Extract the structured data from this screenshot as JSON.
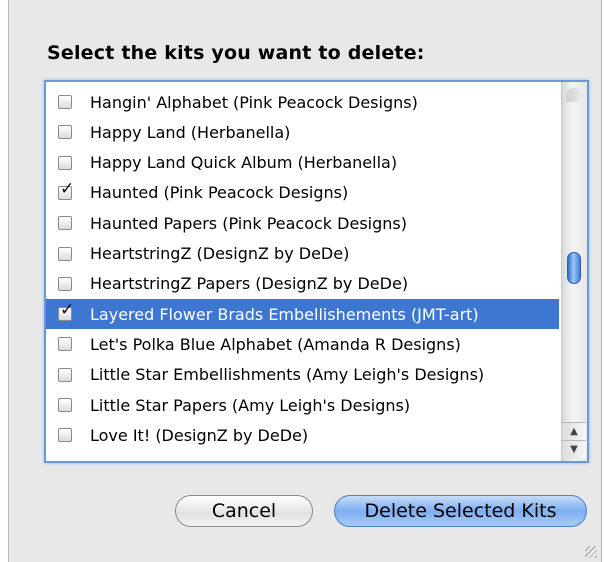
{
  "dialog": {
    "prompt": "Select the kits you want to delete:"
  },
  "kits": [
    {
      "label": "Hangin' Alphabet (Pink Peacock Designs)",
      "checked": false,
      "selected": false
    },
    {
      "label": "Happy Land (Herbanella)",
      "checked": false,
      "selected": false
    },
    {
      "label": "Happy Land Quick Album (Herbanella)",
      "checked": false,
      "selected": false
    },
    {
      "label": "Haunted (Pink Peacock Designs)",
      "checked": true,
      "selected": false
    },
    {
      "label": "Haunted Papers (Pink Peacock Designs)",
      "checked": false,
      "selected": false
    },
    {
      "label": "HeartstringZ (DesignZ by DeDe)",
      "checked": false,
      "selected": false
    },
    {
      "label": "HeartstringZ Papers (DesignZ by DeDe)",
      "checked": false,
      "selected": false
    },
    {
      "label": "Layered Flower Brads Embellishements (JMT-art)",
      "checked": true,
      "selected": true
    },
    {
      "label": "Let's Polka Blue Alphabet (Amanda R Designs)",
      "checked": false,
      "selected": false
    },
    {
      "label": "Little Star Embellishments (Amy Leigh's Designs)",
      "checked": false,
      "selected": false
    },
    {
      "label": "Little Star Papers (Amy Leigh's Designs)",
      "checked": false,
      "selected": false
    },
    {
      "label": "Love It! (DesignZ by DeDe)",
      "checked": false,
      "selected": false
    }
  ],
  "buttons": {
    "cancel": "Cancel",
    "delete": "Delete Selected Kits"
  },
  "colors": {
    "selection": "#3d77d2",
    "focus_ring": "#6a98d8"
  }
}
